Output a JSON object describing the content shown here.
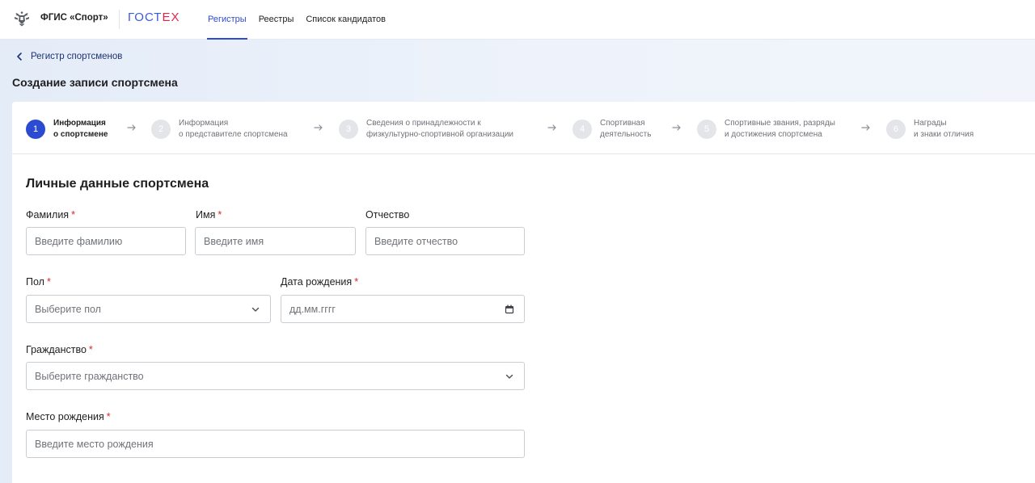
{
  "header": {
    "brand": "ФГИС «Спорт»",
    "partner_main": "ГОСТ",
    "partner_accent": "ЕХ",
    "nav": [
      {
        "label": "Регистры",
        "active": true
      },
      {
        "label": "Реестры",
        "active": false
      },
      {
        "label": "Список кандидатов",
        "active": false
      }
    ],
    "colors": {
      "accent": "#2c4bd1",
      "gostech_blue": "#3b5bdb",
      "gostech_red": "#e0244b"
    }
  },
  "breadcrumb": {
    "back_label": "Регистр спортсменов",
    "icon": "chevron-left-icon"
  },
  "page_title": "Создание записи спортсмена",
  "stepper": [
    {
      "num": "1",
      "line1": "Информация",
      "line2": "о спортсмене",
      "active": true
    },
    {
      "num": "2",
      "line1": "Информация",
      "line2": "о представителе спортсмена",
      "active": false
    },
    {
      "num": "3",
      "line1": "Сведения о принадлежности к",
      "line2": "физкультурно-спортивной организации",
      "active": false
    },
    {
      "num": "4",
      "line1": "Спортивная",
      "line2": "деятельность",
      "active": false
    },
    {
      "num": "5",
      "line1": "Спортивные звания, разряды",
      "line2": "и достижения спортсмена",
      "active": false
    },
    {
      "num": "6",
      "line1": "Награды",
      "line2": "и знаки отличия",
      "active": false
    }
  ],
  "form": {
    "section_title": "Личные данные спортсмена",
    "required_mark": "*",
    "fields": {
      "last_name": {
        "label": "Фамилия",
        "placeholder": "Введите фамилию",
        "required": true
      },
      "first_name": {
        "label": "Имя",
        "placeholder": "Введите имя",
        "required": true
      },
      "middle_name": {
        "label": "Отчество",
        "placeholder": "Введите отчество",
        "required": false
      },
      "gender": {
        "label": "Пол",
        "placeholder": "Выберите пол",
        "required": true,
        "icon": "chevron-down-icon"
      },
      "birth_date": {
        "label": "Дата рождения",
        "placeholder": "дд.мм.гггг",
        "required": true,
        "icon": "calendar-icon"
      },
      "citizenship": {
        "label": "Гражданство",
        "placeholder": "Выберите гражданство",
        "required": true,
        "icon": "chevron-down-icon"
      },
      "birth_place": {
        "label": "Место рождения",
        "placeholder": "Введите место рождения",
        "required": true
      }
    }
  }
}
